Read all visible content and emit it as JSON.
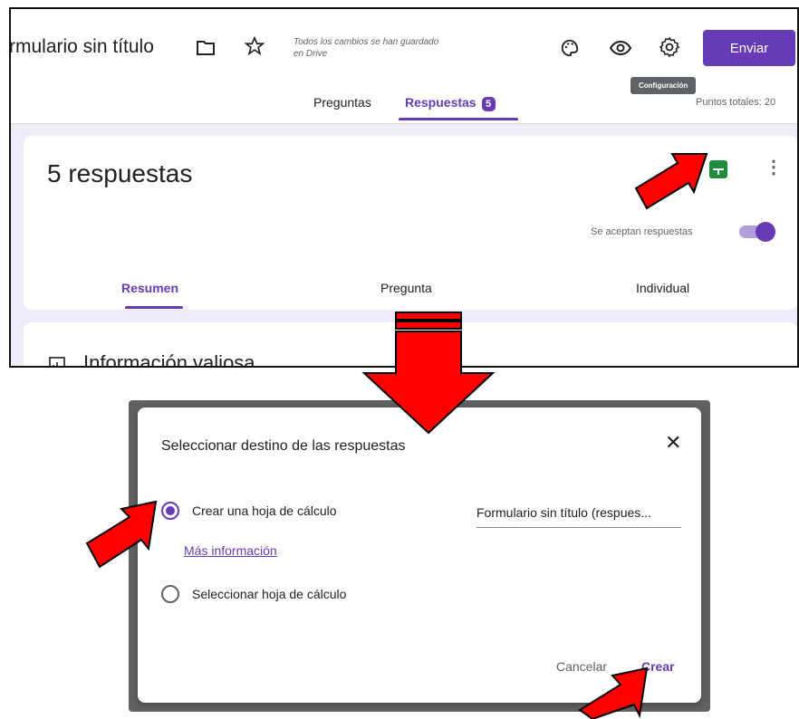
{
  "top": {
    "form_title": "rmulario sin título",
    "saved_status": "Todos los cambios se han guardado en Drive",
    "send_label": "Enviar",
    "tooltip": "Configuración",
    "tabs": [
      {
        "label": "Preguntas"
      },
      {
        "label": "Respuestas",
        "badge": "5"
      }
    ],
    "points_label": "Puntos totales: 20",
    "responses_title": "5 respuestas",
    "accept_label": "Se aceptan respuestas",
    "subtabs": [
      {
        "label": "Resumen"
      },
      {
        "label": "Pregunta"
      },
      {
        "label": "Individual"
      }
    ],
    "insights_title": "Información valiosa",
    "icons": [
      "folder-icon",
      "star-icon",
      "palette-icon",
      "eye-icon",
      "gear-icon",
      "sheets-icon",
      "more-vert-icon",
      "insights-icon"
    ]
  },
  "dialog": {
    "title": "Seleccionar destino de las respuestas",
    "option_create": "Crear una hoja de cálculo",
    "sheet_name": "Formulario sin título (respues...",
    "more_info": "Más información",
    "option_select": "Seleccionar hoja de cálculo",
    "cancel_label": "Cancelar",
    "create_label": "Crear",
    "selected_option": "create"
  },
  "colors": {
    "accent": "#673ab7",
    "sheets_green": "#1e8e3e",
    "arrow_red": "#ff0000",
    "page_bg": "#f0ebf8"
  }
}
